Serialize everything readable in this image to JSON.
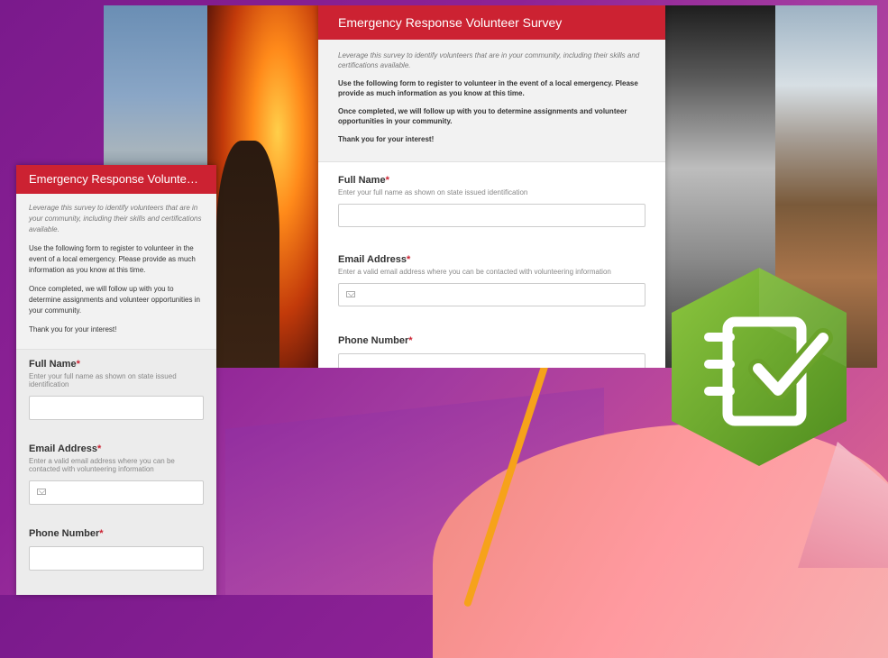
{
  "survey": {
    "title": "Emergency Response Volunteer Survey",
    "title_short": "Emergency Response Volunteer Sur...",
    "intro_italic": "Leverage this survey to identify volunteers that are in your community, including their skills and certifications available.",
    "intro_p1": "Use the following form to register to volunteer in the event of a local emergency. Please provide as much information as you know at this time.",
    "intro_p2": "Once completed, we will follow up with you to determine assignments and volunteer opportunities in your community.",
    "intro_p3": "Thank you for your interest!",
    "required_marker": "*",
    "questions": [
      {
        "label": "Full Name",
        "hint": "Enter your full name as shown on state issued identification",
        "value": ""
      },
      {
        "label": "Email Address",
        "hint": "Enter a valid email address where you can be contacted with volunteering information",
        "value": ""
      },
      {
        "label": "Phone Number",
        "hint": "",
        "value": ""
      }
    ]
  },
  "icons": [
    "mail-icon",
    "survey123-logo"
  ],
  "colors": {
    "header": "#cc2232",
    "logo_green": "#6aa32a",
    "background": "#8e2296"
  }
}
